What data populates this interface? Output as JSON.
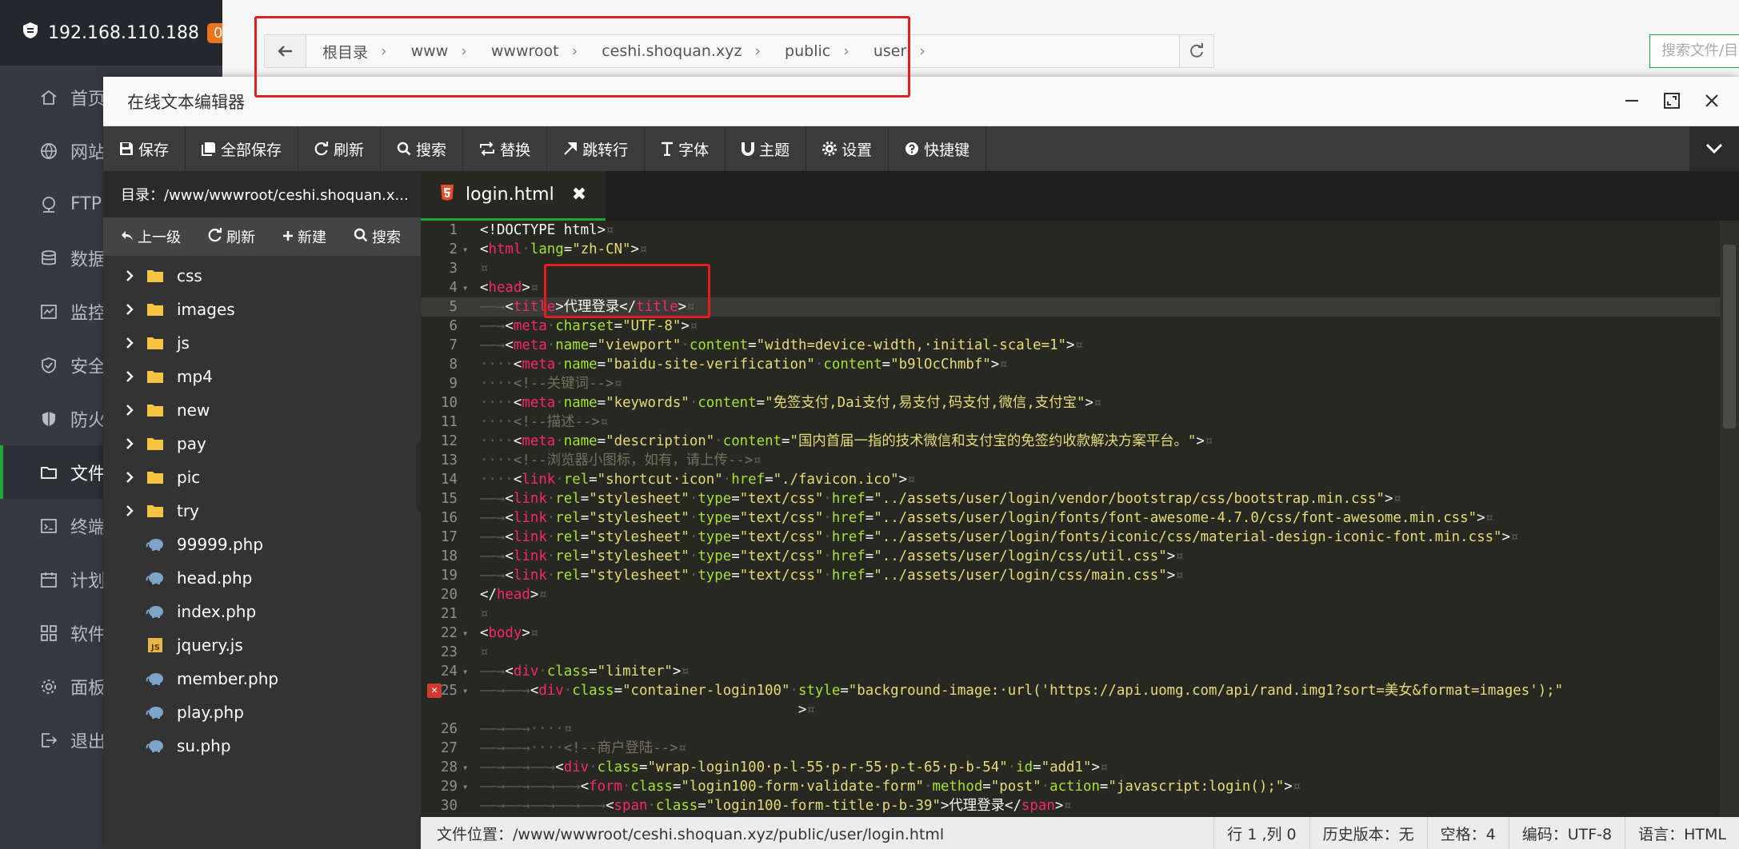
{
  "host": {
    "ip": "192.168.110.188",
    "badge": "0"
  },
  "sidebar": {
    "items": [
      {
        "label": "首页",
        "icon": "home-icon"
      },
      {
        "label": "网站",
        "icon": "globe-icon"
      },
      {
        "label": "FTP",
        "icon": "ftp-icon"
      },
      {
        "label": "数据",
        "icon": "database-icon"
      },
      {
        "label": "监控",
        "icon": "monitor-icon"
      },
      {
        "label": "安全",
        "icon": "shield-check-icon"
      },
      {
        "label": "防火",
        "icon": "firewall-icon"
      },
      {
        "label": "文件",
        "icon": "folder-icon"
      },
      {
        "label": "终端",
        "icon": "terminal-icon"
      },
      {
        "label": "计划",
        "icon": "calendar-icon"
      },
      {
        "label": "软件",
        "icon": "apps-icon"
      },
      {
        "label": "面板",
        "icon": "gear-icon"
      },
      {
        "label": "退出",
        "icon": "logout-icon"
      }
    ],
    "active": "文件"
  },
  "breadcrumb": [
    "根目录",
    "www",
    "wwwroot",
    "ceshi.shoquan.xyz",
    "public",
    "user"
  ],
  "search_files": {
    "placeholder": "搜索文件/目"
  },
  "editor": {
    "title": "在线文本编辑器",
    "toolbar": [
      {
        "label": "保存",
        "icon": "save-icon"
      },
      {
        "label": "全部保存",
        "icon": "save-all-icon"
      },
      {
        "label": "刷新",
        "icon": "refresh-icon"
      },
      {
        "label": "搜索",
        "icon": "search-icon"
      },
      {
        "label": "替换",
        "icon": "replace-icon"
      },
      {
        "label": "跳转行",
        "icon": "jump-icon"
      },
      {
        "label": "字体",
        "icon": "font-icon"
      },
      {
        "label": "主题",
        "icon": "magnet-icon"
      },
      {
        "label": "设置",
        "icon": "gear-icon"
      },
      {
        "label": "快捷键",
        "icon": "question-icon"
      }
    ],
    "directory": "目录：/www/wwwroot/ceshi.shoquan.x...",
    "file_tools": [
      "上一级",
      "刷新",
      "新建",
      "搜索"
    ],
    "folders": [
      "css",
      "images",
      "js",
      "mp4",
      "new",
      "pay",
      "pic",
      "try"
    ],
    "files": [
      {
        "name": "99999.php",
        "type": "php"
      },
      {
        "name": "head.php",
        "type": "php"
      },
      {
        "name": "index.php",
        "type": "php"
      },
      {
        "name": "jquery.js",
        "type": "js"
      },
      {
        "name": "member.php",
        "type": "php"
      },
      {
        "name": "play.php",
        "type": "php"
      },
      {
        "name": "su.php",
        "type": "php"
      }
    ],
    "tab": "login.html",
    "status": {
      "path": "文件位置：/www/wwwroot/ceshi.shoquan.xyz/public/user/login.html",
      "position": "行 1 ,列 0",
      "history": "历史版本：无",
      "spaces": "空格：4",
      "encoding": "编码：UTF-8",
      "language": "语言：HTML"
    }
  },
  "code_lines": [
    {
      "n": "1",
      "f": "",
      "ws": "",
      "parts": [
        [
          "p",
          "<!DOCTYPE html>"
        ],
        [
          "ws",
          "¤"
        ]
      ]
    },
    {
      "n": "2",
      "f": "▾",
      "ws": "",
      "parts": [
        [
          "p",
          "<"
        ],
        [
          "t",
          "html"
        ],
        [
          "ws",
          "·"
        ],
        [
          "a",
          "lang"
        ],
        [
          "p",
          "="
        ],
        [
          "s",
          "\"zh-CN\""
        ],
        [
          "p",
          ">"
        ],
        [
          "ws",
          "¤"
        ]
      ]
    },
    {
      "n": "3",
      "f": "",
      "ws": "",
      "parts": [
        [
          "ws",
          "¤"
        ]
      ]
    },
    {
      "n": "4",
      "f": "▾",
      "ws": "",
      "parts": [
        [
          "p",
          "<"
        ],
        [
          "t",
          "head"
        ],
        [
          "p",
          ">"
        ],
        [
          "ws",
          "¤"
        ]
      ]
    },
    {
      "n": "5",
      "f": "",
      "ws": "——→",
      "parts": [
        [
          "p",
          "<"
        ],
        [
          "t",
          "title"
        ],
        [
          "p",
          ">代理登录</"
        ],
        [
          "t",
          "title"
        ],
        [
          "p",
          ">"
        ],
        [
          "ws",
          "¤"
        ]
      ]
    },
    {
      "n": "6",
      "f": "",
      "ws": "——→",
      "parts": [
        [
          "p",
          "<"
        ],
        [
          "t",
          "meta"
        ],
        [
          "ws",
          "·"
        ],
        [
          "a",
          "charset"
        ],
        [
          "p",
          "="
        ],
        [
          "s",
          "\"UTF-8\""
        ],
        [
          "p",
          ">"
        ],
        [
          "ws",
          "¤"
        ]
      ]
    },
    {
      "n": "7",
      "f": "",
      "ws": "——→",
      "parts": [
        [
          "p",
          "<"
        ],
        [
          "t",
          "meta"
        ],
        [
          "ws",
          "·"
        ],
        [
          "a",
          "name"
        ],
        [
          "p",
          "="
        ],
        [
          "s",
          "\"viewport\""
        ],
        [
          "ws",
          "·"
        ],
        [
          "a",
          "content"
        ],
        [
          "p",
          "="
        ],
        [
          "s",
          "\"width=device-width,·initial-scale=1\""
        ],
        [
          "p",
          ">"
        ],
        [
          "ws",
          "¤"
        ]
      ]
    },
    {
      "n": "8",
      "f": "",
      "ws": "····",
      "parts": [
        [
          "p",
          "<"
        ],
        [
          "t",
          "meta"
        ],
        [
          "ws",
          "·"
        ],
        [
          "a",
          "name"
        ],
        [
          "p",
          "="
        ],
        [
          "s",
          "\"baidu-site-verification\""
        ],
        [
          "ws",
          "·"
        ],
        [
          "a",
          "content"
        ],
        [
          "p",
          "="
        ],
        [
          "s",
          "\"b9lOcChmbf\""
        ],
        [
          "p",
          ">"
        ],
        [
          "ws",
          "¤"
        ]
      ]
    },
    {
      "n": "9",
      "f": "",
      "ws": "····",
      "parts": [
        [
          "c",
          "<!--关键词-->"
        ],
        [
          "ws",
          "¤"
        ]
      ]
    },
    {
      "n": "10",
      "f": "",
      "ws": "····",
      "parts": [
        [
          "p",
          "<"
        ],
        [
          "t",
          "meta"
        ],
        [
          "ws",
          "·"
        ],
        [
          "a",
          "name"
        ],
        [
          "p",
          "="
        ],
        [
          "s",
          "\"keywords\""
        ],
        [
          "ws",
          "·"
        ],
        [
          "a",
          "content"
        ],
        [
          "p",
          "="
        ],
        [
          "s",
          "\"免签支付,Dai支付,易支付,码支付,微信,支付宝\""
        ],
        [
          "p",
          ">"
        ],
        [
          "ws",
          "¤"
        ]
      ]
    },
    {
      "n": "11",
      "f": "",
      "ws": "····",
      "parts": [
        [
          "c",
          "<!--描述-->"
        ],
        [
          "ws",
          "¤"
        ]
      ]
    },
    {
      "n": "12",
      "f": "",
      "ws": "····",
      "parts": [
        [
          "p",
          "<"
        ],
        [
          "t",
          "meta"
        ],
        [
          "ws",
          "·"
        ],
        [
          "a",
          "name"
        ],
        [
          "p",
          "="
        ],
        [
          "s",
          "\"description\""
        ],
        [
          "ws",
          "·"
        ],
        [
          "a",
          "content"
        ],
        [
          "p",
          "="
        ],
        [
          "s",
          "\"国内首届一指的技术微信和支付宝的免签约收款解决方案平台。\""
        ],
        [
          "p",
          ">"
        ],
        [
          "ws",
          "¤"
        ]
      ]
    },
    {
      "n": "13",
      "f": "",
      "ws": "····",
      "parts": [
        [
          "c",
          "<!--浏览器小图标，如有，请上传-->"
        ],
        [
          "ws",
          "¤"
        ]
      ]
    },
    {
      "n": "14",
      "f": "",
      "ws": "····",
      "parts": [
        [
          "p",
          "<"
        ],
        [
          "t",
          "link"
        ],
        [
          "ws",
          "·"
        ],
        [
          "a",
          "rel"
        ],
        [
          "p",
          "="
        ],
        [
          "s",
          "\"shortcut·icon\""
        ],
        [
          "ws",
          "·"
        ],
        [
          "a",
          "href"
        ],
        [
          "p",
          "="
        ],
        [
          "s",
          "\"./favicon.ico\""
        ],
        [
          "p",
          ">"
        ],
        [
          "ws",
          "¤"
        ]
      ]
    },
    {
      "n": "15",
      "f": "",
      "ws": "——→",
      "parts": [
        [
          "p",
          "<"
        ],
        [
          "t",
          "link"
        ],
        [
          "ws",
          "·"
        ],
        [
          "a",
          "rel"
        ],
        [
          "p",
          "="
        ],
        [
          "s",
          "\"stylesheet\""
        ],
        [
          "ws",
          "·"
        ],
        [
          "a",
          "type"
        ],
        [
          "p",
          "="
        ],
        [
          "s",
          "\"text/css\""
        ],
        [
          "ws",
          "·"
        ],
        [
          "a",
          "href"
        ],
        [
          "p",
          "="
        ],
        [
          "s",
          "\"../assets/user/login/vendor/bootstrap/css/bootstrap.min.css\""
        ],
        [
          "p",
          ">"
        ],
        [
          "ws",
          "¤"
        ]
      ]
    },
    {
      "n": "16",
      "f": "",
      "ws": "——→",
      "parts": [
        [
          "p",
          "<"
        ],
        [
          "t",
          "link"
        ],
        [
          "ws",
          "·"
        ],
        [
          "a",
          "rel"
        ],
        [
          "p",
          "="
        ],
        [
          "s",
          "\"stylesheet\""
        ],
        [
          "ws",
          "·"
        ],
        [
          "a",
          "type"
        ],
        [
          "p",
          "="
        ],
        [
          "s",
          "\"text/css\""
        ],
        [
          "ws",
          "·"
        ],
        [
          "a",
          "href"
        ],
        [
          "p",
          "="
        ],
        [
          "s",
          "\"../assets/user/login/fonts/font-awesome-4.7.0/css/font-awesome.min.css\""
        ],
        [
          "p",
          ">"
        ],
        [
          "ws",
          "¤"
        ]
      ]
    },
    {
      "n": "17",
      "f": "",
      "ws": "——→",
      "parts": [
        [
          "p",
          "<"
        ],
        [
          "t",
          "link"
        ],
        [
          "ws",
          "·"
        ],
        [
          "a",
          "rel"
        ],
        [
          "p",
          "="
        ],
        [
          "s",
          "\"stylesheet\""
        ],
        [
          "ws",
          "·"
        ],
        [
          "a",
          "type"
        ],
        [
          "p",
          "="
        ],
        [
          "s",
          "\"text/css\""
        ],
        [
          "ws",
          "·"
        ],
        [
          "a",
          "href"
        ],
        [
          "p",
          "="
        ],
        [
          "s",
          "\"../assets/user/login/fonts/iconic/css/material-design-iconic-font.min.css\""
        ],
        [
          "p",
          ">"
        ],
        [
          "ws",
          "¤"
        ]
      ]
    },
    {
      "n": "18",
      "f": "",
      "ws": "——→",
      "parts": [
        [
          "p",
          "<"
        ],
        [
          "t",
          "link"
        ],
        [
          "ws",
          "·"
        ],
        [
          "a",
          "rel"
        ],
        [
          "p",
          "="
        ],
        [
          "s",
          "\"stylesheet\""
        ],
        [
          "ws",
          "·"
        ],
        [
          "a",
          "type"
        ],
        [
          "p",
          "="
        ],
        [
          "s",
          "\"text/css\""
        ],
        [
          "ws",
          "·"
        ],
        [
          "a",
          "href"
        ],
        [
          "p",
          "="
        ],
        [
          "s",
          "\"../assets/user/login/css/util.css\""
        ],
        [
          "p",
          ">"
        ],
        [
          "ws",
          "¤"
        ]
      ]
    },
    {
      "n": "19",
      "f": "",
      "ws": "——→",
      "parts": [
        [
          "p",
          "<"
        ],
        [
          "t",
          "link"
        ],
        [
          "ws",
          "·"
        ],
        [
          "a",
          "rel"
        ],
        [
          "p",
          "="
        ],
        [
          "s",
          "\"stylesheet\""
        ],
        [
          "ws",
          "·"
        ],
        [
          "a",
          "type"
        ],
        [
          "p",
          "="
        ],
        [
          "s",
          "\"text/css\""
        ],
        [
          "ws",
          "·"
        ],
        [
          "a",
          "href"
        ],
        [
          "p",
          "="
        ],
        [
          "s",
          "\"../assets/user/login/css/main.css\""
        ],
        [
          "p",
          ">"
        ],
        [
          "ws",
          "¤"
        ]
      ]
    },
    {
      "n": "20",
      "f": "",
      "ws": "",
      "parts": [
        [
          "p",
          "</"
        ],
        [
          "t",
          "head"
        ],
        [
          "p",
          ">"
        ],
        [
          "ws",
          "¤"
        ]
      ]
    },
    {
      "n": "21",
      "f": "",
      "ws": "",
      "parts": [
        [
          "ws",
          "¤"
        ]
      ]
    },
    {
      "n": "22",
      "f": "▾",
      "ws": "",
      "parts": [
        [
          "p",
          "<"
        ],
        [
          "t",
          "body"
        ],
        [
          "p",
          ">"
        ],
        [
          "ws",
          "¤"
        ]
      ]
    },
    {
      "n": "23",
      "f": "",
      "ws": "",
      "parts": [
        [
          "ws",
          "¤"
        ]
      ]
    },
    {
      "n": "24",
      "f": "▾",
      "ws": "——→",
      "parts": [
        [
          "p",
          "<"
        ],
        [
          "t",
          "div"
        ],
        [
          "ws",
          "·"
        ],
        [
          "a",
          "class"
        ],
        [
          "p",
          "="
        ],
        [
          "s",
          "\"limiter\""
        ],
        [
          "p",
          ">"
        ],
        [
          "ws",
          "¤"
        ]
      ]
    },
    {
      "n": "25",
      "f": "▾",
      "ws": "——→——→",
      "parts": [
        [
          "p",
          "<"
        ],
        [
          "t",
          "div"
        ],
        [
          "ws",
          "·"
        ],
        [
          "a",
          "class"
        ],
        [
          "p",
          "="
        ],
        [
          "s",
          "\"container-login100\""
        ],
        [
          "ws",
          "·"
        ],
        [
          "a",
          "style"
        ],
        [
          "p",
          "="
        ],
        [
          "s",
          "\"background-image:·url('https://api.uomg.com/api/rand.img1?sort=美女&format=images');\""
        ]
      ]
    },
    {
      "n": "",
      "f": "",
      "ws": "                                      ",
      "parts": [
        [
          "p",
          ">"
        ],
        [
          "ws",
          "¤"
        ]
      ]
    },
    {
      "n": "26",
      "f": "",
      "ws": "——→——→····",
      "parts": [
        [
          "ws",
          "¤"
        ]
      ]
    },
    {
      "n": "27",
      "f": "",
      "ws": "——→——→····",
      "parts": [
        [
          "c",
          "<!--商户登陆-->"
        ],
        [
          "ws",
          "¤"
        ]
      ]
    },
    {
      "n": "28",
      "f": "▾",
      "ws": "——→——→——→",
      "parts": [
        [
          "p",
          "<"
        ],
        [
          "t",
          "div"
        ],
        [
          "ws",
          "·"
        ],
        [
          "a",
          "class"
        ],
        [
          "p",
          "="
        ],
        [
          "s",
          "\"wrap-login100·p-l-55·p-r-55·p-t-65·p-b-54\""
        ],
        [
          "ws",
          "·"
        ],
        [
          "a",
          "id"
        ],
        [
          "p",
          "="
        ],
        [
          "s",
          "\"add1\""
        ],
        [
          "p",
          ">"
        ],
        [
          "ws",
          "¤"
        ]
      ]
    },
    {
      "n": "29",
      "f": "▾",
      "ws": "——→——→——→——→",
      "parts": [
        [
          "p",
          "<"
        ],
        [
          "t",
          "form"
        ],
        [
          "ws",
          "·"
        ],
        [
          "a",
          "class"
        ],
        [
          "p",
          "="
        ],
        [
          "s",
          "\"login100-form·validate-form\""
        ],
        [
          "ws",
          "·"
        ],
        [
          "a",
          "method"
        ],
        [
          "p",
          "="
        ],
        [
          "s",
          "\"post\""
        ],
        [
          "ws",
          "·"
        ],
        [
          "a",
          "action"
        ],
        [
          "p",
          "="
        ],
        [
          "s",
          "\"javascript:login();\""
        ],
        [
          "p",
          ">"
        ],
        [
          "ws",
          "¤"
        ]
      ]
    },
    {
      "n": "30",
      "f": "",
      "ws": "——→——→——→——→——→",
      "parts": [
        [
          "p",
          "<"
        ],
        [
          "t",
          "span"
        ],
        [
          "ws",
          "·"
        ],
        [
          "a",
          "class"
        ],
        [
          "p",
          "="
        ],
        [
          "s",
          "\"login100-form-title·p-b-39\""
        ],
        [
          "p",
          ">代理登录</"
        ],
        [
          "t",
          "span"
        ],
        [
          "p",
          ">"
        ],
        [
          "ws",
          "¤"
        ]
      ]
    }
  ]
}
